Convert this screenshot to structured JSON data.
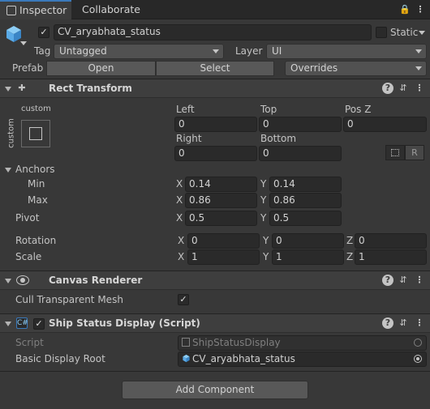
{
  "tabs": {
    "inspector": "Inspector",
    "collaborate": "Collaborate"
  },
  "object": {
    "name": "CV_aryabhata_status",
    "active": true,
    "static_label": "Static"
  },
  "tag": {
    "label": "Tag",
    "value": "Untagged"
  },
  "layer": {
    "label": "Layer",
    "value": "UI"
  },
  "prefab": {
    "label": "Prefab",
    "open": "Open",
    "select": "Select",
    "overrides": "Overrides"
  },
  "rect_transform": {
    "title": "Rect Transform",
    "anchor_preset_top": "custom",
    "anchor_preset_side": "custom",
    "left_label": "Left",
    "left": "0",
    "top_label": "Top",
    "top": "0",
    "posz_label": "Pos Z",
    "posz": "0",
    "right_label": "Right",
    "right": "0",
    "bottom_label": "Bottom",
    "bottom": "0",
    "r_button": "R",
    "anchors_label": "Anchors",
    "min_label": "Min",
    "min_x": "0.14",
    "min_y": "0.14",
    "max_label": "Max",
    "max_x": "0.86",
    "max_y": "0.86",
    "pivot_label": "Pivot",
    "pivot_x": "0.5",
    "pivot_y": "0.5",
    "rotation_label": "Rotation",
    "rot_x": "0",
    "rot_y": "0",
    "rot_z": "0",
    "scale_label": "Scale",
    "scale_x": "1",
    "scale_y": "1",
    "scale_z": "1",
    "x": "X",
    "y": "Y",
    "z": "Z"
  },
  "canvas_renderer": {
    "title": "Canvas Renderer",
    "cull_label": "Cull Transparent Mesh",
    "cull_checked": true
  },
  "ship_status": {
    "title": "Ship Status Display (Script)",
    "script_label": "Script",
    "script_value": "ShipStatusDisplay",
    "root_label": "Basic Display Root",
    "root_value": "CV_aryabhata_status"
  },
  "add_component": "Add Component",
  "colors": {
    "background": "#383838",
    "header": "#3e3e3e",
    "field": "#2a2a2a",
    "tab_accent": "#3a79bb",
    "gameobject_icon": "#5aaae6"
  }
}
